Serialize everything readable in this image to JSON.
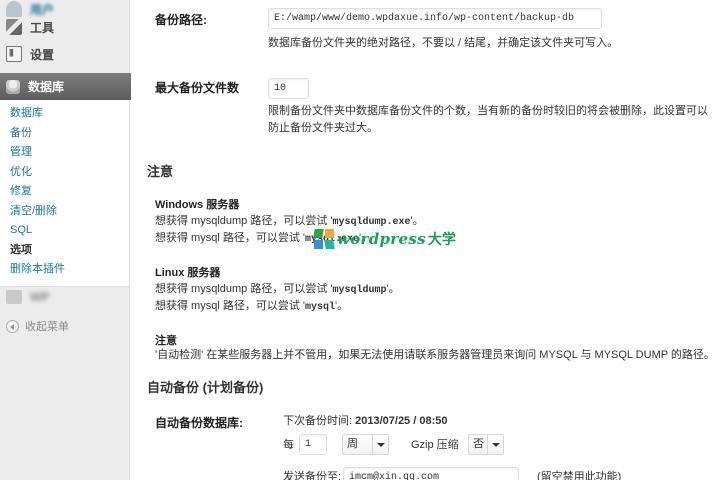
{
  "sidebar": {
    "users_label": "用户",
    "tools_label": "工具",
    "settings_label": "设置",
    "db_label": "数据库",
    "submenu": [
      {
        "label": "数据库"
      },
      {
        "label": "备份"
      },
      {
        "label": "管理"
      },
      {
        "label": "优化"
      },
      {
        "label": "修复"
      },
      {
        "label": "清空/删除"
      },
      {
        "label": "SQL"
      },
      {
        "label": "选项",
        "current": true
      },
      {
        "label": "删除本插件"
      }
    ],
    "blurred_label": "WP",
    "collapse_label": "收起菜单"
  },
  "backup_path": {
    "label": "备份路径:",
    "value": "E:/wamp/www/demo.wpdaxue.info/wp-content/backup-db",
    "desc": "数据库备份文件夹的绝对路径，不要以 / 结尾，并确定该文件夹可写入。"
  },
  "max_backup": {
    "label": "最大备份文件数",
    "value": "10",
    "desc_line1": "限制备份文件夹中数据库备份文件的个数，当有新的备份时较旧的将会被删除，此设置可以",
    "desc_line2": "防止备份文件夹过大。"
  },
  "notes": {
    "heading": "注意",
    "windows_title": "Windows 服务器",
    "windows_line1_pre": "想获得 mysqldump 路径，可以尝试 '",
    "windows_line1_code": "mysqldump.exe",
    "windows_line1_post": "'。",
    "windows_line2_pre": "想获得 mysql 路径，可以尝试 '",
    "windows_line2_code": "mysql.exe",
    "windows_line2_post": "'。",
    "linux_title": "Linux 服务器",
    "linux_line1_pre": "想获得 mysqldump 路径，可以尝试 '",
    "linux_line1_code": "mysqldump",
    "linux_line1_post": "'。",
    "linux_line2_pre": "想获得 mysql 路径，可以尝试 '",
    "linux_line2_code": "mysql",
    "linux_line2_post": "'。",
    "note_title": "注意",
    "note_text": "'自动检测' 在某些服务器上并不管用，如果无法使用请联系服务器管理员来询问 MYSQL 与 MYSQL DUMP 的路径。"
  },
  "auto_backup": {
    "heading": "自动备份 (计划备份)",
    "label": "自动备份数据库:",
    "next_time_label": "下次备份时间:",
    "next_time_value": "2013/07/25 / 08:50",
    "every_label": "每",
    "every_value": "1",
    "unit_value": "周",
    "gzip_label": "Gzip 压缩",
    "gzip_value": "否",
    "email_label": "发送备份至:",
    "email_value": "imcm@xin.qq.com",
    "email_hint": "(留空禁用此功能)"
  },
  "watermark": {
    "text": "wordpress",
    "cn": "大学"
  }
}
